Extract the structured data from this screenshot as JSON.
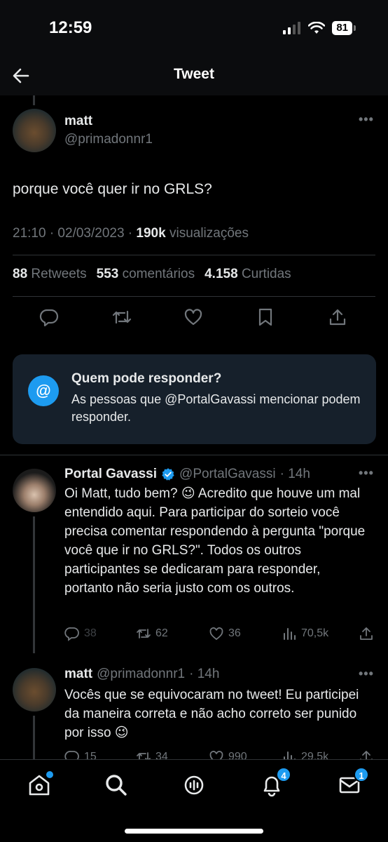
{
  "status_bar": {
    "time": "12:59",
    "battery": "81"
  },
  "nav": {
    "title": "Tweet"
  },
  "tweet": {
    "name": "matt",
    "handle": "@primadonnr1",
    "text": "porque você quer ir no GRLS?",
    "time": "21:10 · 02/03/2023 ·",
    "views_value": "190k",
    "views_label": "visualizações",
    "retweets_value": "88",
    "retweets_label": "Retweets",
    "comments_value": "553",
    "comments_label": "comentários",
    "likes_value": "4.158",
    "likes_label": "Curtidas"
  },
  "reply_restriction": {
    "title": "Quem pode responder?",
    "description": "As pessoas que @PortalGavassi mencionar podem responder."
  },
  "replies": [
    {
      "name": "Portal Gavassi",
      "handle": "@PortalGavassi",
      "time": "· 14h",
      "text": "Oi Matt, tudo bem? 😉 Acredito que houve um mal entendido aqui. Para participar do sorteio você precisa comentar respondendo à pergunta \"porque você que ir no GRLS?\". Todos os outros participantes se dedicaram para responder, portanto não seria justo com os outros.",
      "replies": "38",
      "retweets": "62",
      "likes": "36",
      "views": "70,5k"
    },
    {
      "name": "matt",
      "handle": "@primadonnr1",
      "time": "· 14h",
      "text": "Vocês que se equivocaram no tweet! Eu participei da maneira correta e não acho correto ser punido por isso 😉",
      "replies": "15",
      "retweets": "34",
      "likes": "990",
      "views": "29,5k"
    }
  ],
  "tab_bar": {
    "notifications_badge": "4",
    "messages_badge": "1"
  },
  "colors": {
    "accent": "#1d9bf0",
    "background": "#000000",
    "muted": "#71767b"
  }
}
